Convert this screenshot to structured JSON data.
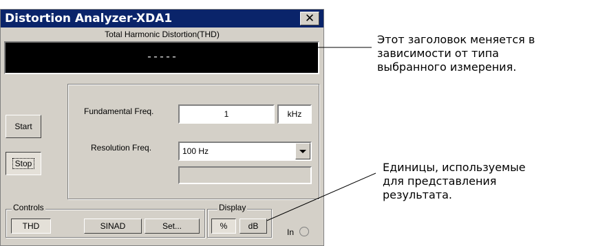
{
  "window": {
    "title": "Distortion Analyzer-XDA1",
    "close_glyph": "✕",
    "subtitle": "Total Harmonic Distortion(THD)",
    "display_value": "-----"
  },
  "buttons": {
    "start": "Start",
    "stop": "Stop"
  },
  "fundamental": {
    "label": "Fundamental Freq.",
    "value": "1",
    "unit": "kHz"
  },
  "resolution": {
    "label": "Resolution Freq.",
    "value": "100 Hz"
  },
  "controls": {
    "label": "Controls",
    "thd": "THD",
    "sinad": "SINAD",
    "set": "Set..."
  },
  "display_group": {
    "label": "Display",
    "percent": "%",
    "db": "dB"
  },
  "in_label": "In",
  "annotations": {
    "title_note": [
      "Этот заголовок меняется в",
      "зависимости от типа",
      "выбранного измерения."
    ],
    "units_note": [
      "Единицы, используемые",
      "для представления",
      "результата."
    ]
  }
}
